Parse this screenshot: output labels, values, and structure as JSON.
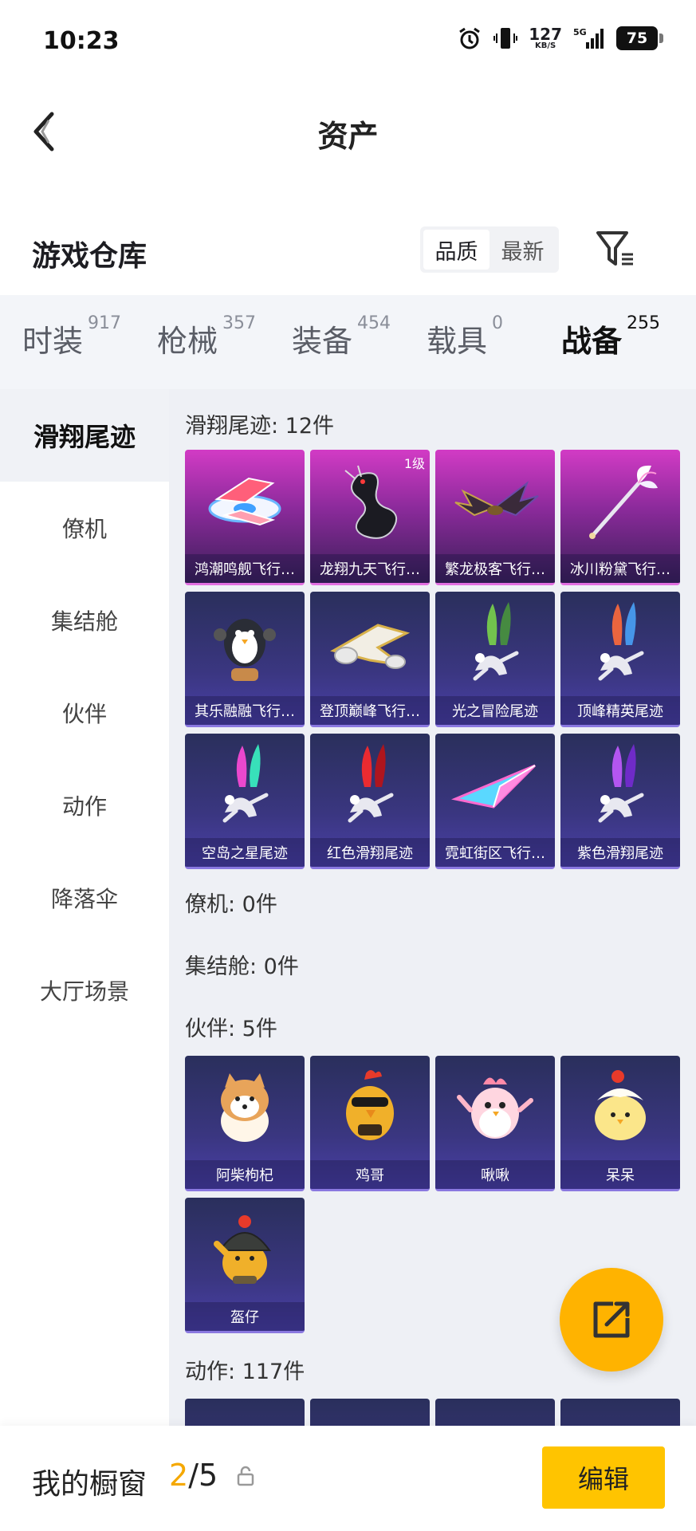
{
  "status_bar": {
    "time": "10:23",
    "net_speed": "127",
    "net_unit": "KB/S",
    "network": "5G",
    "battery": "75"
  },
  "header": {
    "title": "资产"
  },
  "warehouse": {
    "title": "游戏仓库",
    "sort_options": [
      {
        "label": "品质",
        "active": true
      },
      {
        "label": "最新",
        "active": false
      }
    ]
  },
  "category_tabs": [
    {
      "label": "时装",
      "count": "917"
    },
    {
      "label": "枪械",
      "count": "357"
    },
    {
      "label": "装备",
      "count": "454"
    },
    {
      "label": "载具",
      "count": "0"
    },
    {
      "label": "战备",
      "count": "255",
      "active": true
    }
  ],
  "sidebar": {
    "items": [
      {
        "label": "滑翔尾迹",
        "active": true
      },
      {
        "label": "僚机"
      },
      {
        "label": "集结舱"
      },
      {
        "label": "伙伴"
      },
      {
        "label": "动作"
      },
      {
        "label": "降落伞"
      },
      {
        "label": "大厅场景"
      }
    ]
  },
  "sections": {
    "glide": {
      "title": "滑翔尾迹: 12件",
      "items": [
        {
          "name": "鸿潮鸣舰飞行…",
          "rarity": "pink",
          "icon": "spaceship-icon"
        },
        {
          "name": "龙翔九天飞行…",
          "rarity": "pink",
          "badge": "1级",
          "icon": "dragon-icon"
        },
        {
          "name": "繁龙极客飞行…",
          "rarity": "pink",
          "icon": "bat-dragon-icon"
        },
        {
          "name": "冰川粉黛飞行…",
          "rarity": "pink",
          "icon": "wing-staff-icon"
        },
        {
          "name": "其乐融融飞行…",
          "rarity": "purple",
          "icon": "penguin-icon"
        },
        {
          "name": "登顶巅峰飞行…",
          "rarity": "purple",
          "icon": "jet-icon"
        },
        {
          "name": "光之冒险尾迹",
          "rarity": "purple",
          "icon": "smoke-trail-icon",
          "colors": [
            "#7ad34a",
            "#4a9a3a"
          ]
        },
        {
          "name": "顶峰精英尾迹",
          "rarity": "purple",
          "icon": "smoke-trail-icon",
          "colors": [
            "#ff6a3a",
            "#4aa8ff"
          ]
        },
        {
          "name": "空岛之星尾迹",
          "rarity": "purple",
          "icon": "smoke-trail-icon",
          "colors": [
            "#ff4ad8",
            "#3affc8"
          ]
        },
        {
          "name": "红色滑翔尾迹",
          "rarity": "purple",
          "icon": "smoke-trail-icon",
          "colors": [
            "#ff2a2a",
            "#c41010"
          ]
        },
        {
          "name": "霓虹街区飞行…",
          "rarity": "purple",
          "icon": "paper-plane-icon"
        },
        {
          "name": "紫色滑翔尾迹",
          "rarity": "purple",
          "icon": "smoke-trail-icon",
          "colors": [
            "#c25aff",
            "#7a2ad8"
          ]
        }
      ]
    },
    "wingman": {
      "title": "僚机: 0件"
    },
    "assembly": {
      "title": "集结舱: 0件"
    },
    "partner": {
      "title": "伙伴: 5件",
      "items": [
        {
          "name": "阿柴枸杞",
          "rarity": "purple",
          "icon": "shiba-icon"
        },
        {
          "name": "鸡哥",
          "rarity": "purple",
          "icon": "rooster-icon"
        },
        {
          "name": "啾啾",
          "rarity": "purple",
          "icon": "pink-bird-icon"
        },
        {
          "name": "呆呆",
          "rarity": "purple",
          "icon": "chick-icon"
        },
        {
          "name": "盔仔",
          "rarity": "purple",
          "icon": "helmet-chick-icon"
        }
      ]
    },
    "action": {
      "title": "动作: 117件"
    }
  },
  "bottom_bar": {
    "title": "我的橱窗",
    "current": "2",
    "total": "/5",
    "button": "编辑"
  },
  "colors": {
    "accent": "#ffc400",
    "tab_underline": "#f5b400",
    "count_highlight": "#f5a800"
  }
}
